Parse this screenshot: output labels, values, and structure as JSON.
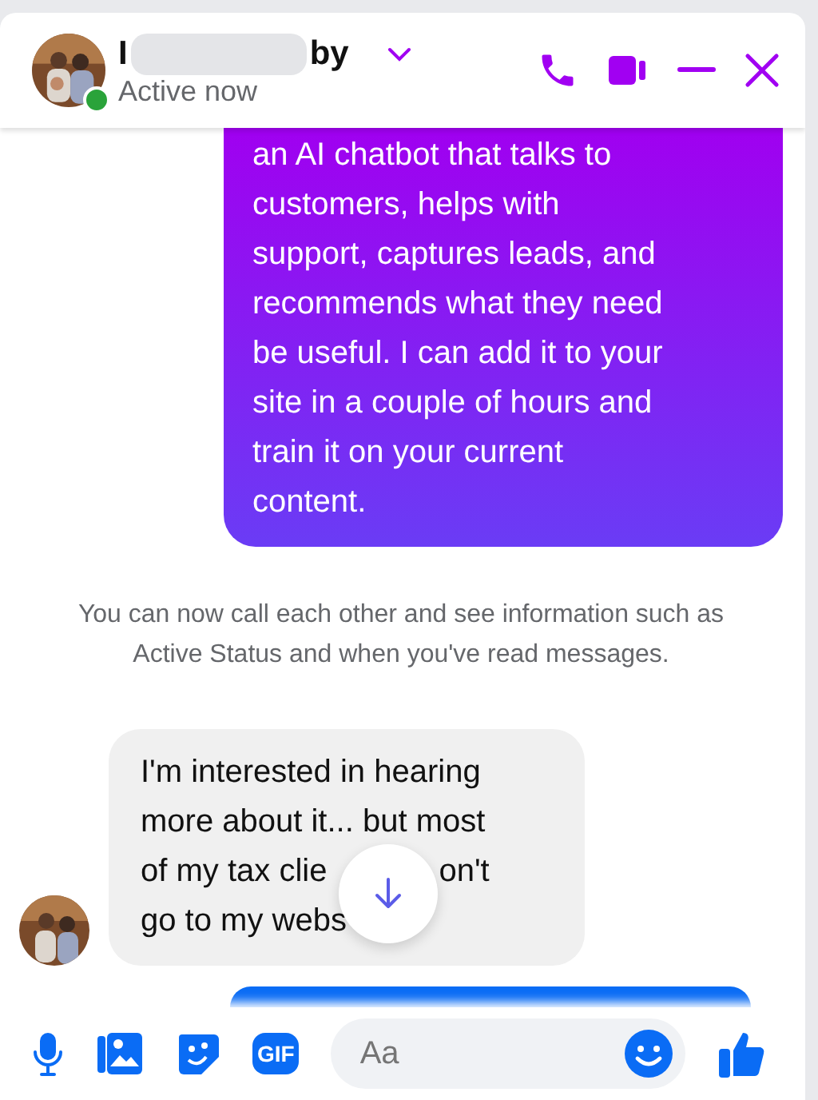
{
  "header": {
    "name_start": "I",
    "name_end": "by",
    "name_redacted": true,
    "status": "Active now",
    "online": true
  },
  "messages": [
    {
      "kind": "sent",
      "lines": [
        "an AI chatbot that talks to",
        "customers, helps with",
        "support, captures leads, and",
        "recommends what they need",
        "be useful. I can add it to your",
        "site in a couple of hours and",
        "train it on your current",
        "content."
      ]
    },
    {
      "kind": "notice",
      "text": "You can now call each other and see information such as Active Status and when you've read messages."
    },
    {
      "kind": "received",
      "lines": [
        "I'm interested in hearing",
        "more about it... but most"
      ],
      "covered_lines": [
        {
          "left": "of my tax clie",
          "right": "on't"
        },
        {
          "left": "go to my webs"
        }
      ]
    },
    {
      "kind": "sent_partial"
    }
  ],
  "composer": {
    "gif_label": "GIF",
    "placeholder": "Aa"
  }
}
